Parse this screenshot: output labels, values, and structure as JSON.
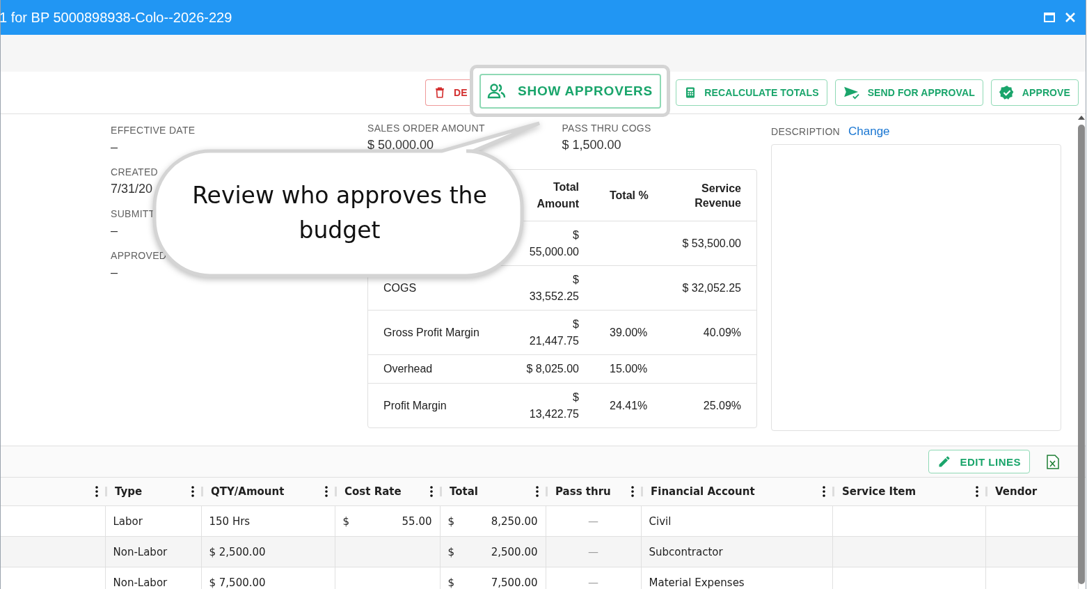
{
  "window": {
    "title": "1 for BP 5000898938-Colo--2026-229"
  },
  "toolbar": {
    "buttons": [
      {
        "kind": "delete",
        "label": "DE"
      },
      {
        "kind": "recalculate",
        "label": "RECALCULATE TOTALS"
      },
      {
        "kind": "send",
        "label": "SEND FOR APPROVAL"
      },
      {
        "kind": "approve",
        "label": "APPROVE"
      }
    ]
  },
  "highlight": {
    "button": {
      "label": "SHOW APPROVERS"
    }
  },
  "callout": {
    "text": "Review who approves the budget"
  },
  "info_fields": [
    {
      "label": "EFFECTIVE DATE",
      "value": "–"
    },
    {
      "label": "CREATED",
      "value": "7/31/20"
    },
    {
      "label": "SUBMITT",
      "value": "–"
    },
    {
      "label": "APPROVED",
      "value": "–"
    }
  ],
  "summary_fields": [
    {
      "label": "SALES ORDER AMOUNT",
      "value": "$ 50,000.00"
    },
    {
      "label": "PASS THRU COGS",
      "value": "$ 1,500.00"
    }
  ],
  "summary_table": {
    "columns": [
      "Total Amount",
      "Total %",
      "Service Revenue"
    ],
    "rows": [
      {
        "amount": "$ 55,000.00",
        "revenue": "$ 53,500.00"
      },
      {
        "label": "COGS",
        "amount": "$ 33,552.25",
        "revenue": "$ 32,052.25"
      },
      {
        "label": "Gross Profit Margin",
        "amount": "$ 21,447.75",
        "percent": "39.00%",
        "revenue": "40.09%"
      },
      {
        "label": "Overhead",
        "amount": "$ 8,025.00",
        "percent": "15.00%"
      },
      {
        "label": "Profit Margin",
        "amount": "$ 13,422.75",
        "percent": "24.41%",
        "revenue": "25.09%"
      }
    ]
  },
  "description": {
    "label": "DESCRIPTION",
    "link": "Change"
  },
  "lines_grid": {
    "edit_button": "EDIT LINES",
    "columns": [
      "Type",
      "QTY/Amount",
      "Cost Rate",
      "Total",
      "Pass thru",
      "Financial Account",
      "Service Item",
      "Vendor"
    ],
    "rows": [
      {
        "type": "Labor",
        "qty": "150 Hrs",
        "cost_currency": "$",
        "cost_rate": "55.00",
        "total_currency": "$",
        "total": "8,250.00",
        "pass_thru": "—",
        "financial_account": "Civil"
      },
      {
        "type": "Non-Labor",
        "qty": "$ 2,500.00",
        "total_currency": "$",
        "total": "2,500.00",
        "pass_thru": "—",
        "financial_account": "Subcontractor"
      },
      {
        "type": "Non-Labor",
        "qty": "$ 7,500.00",
        "total_currency": "$",
        "total": "7,500.00",
        "pass_thru": "—",
        "financial_account": "Material Expenses"
      }
    ]
  }
}
